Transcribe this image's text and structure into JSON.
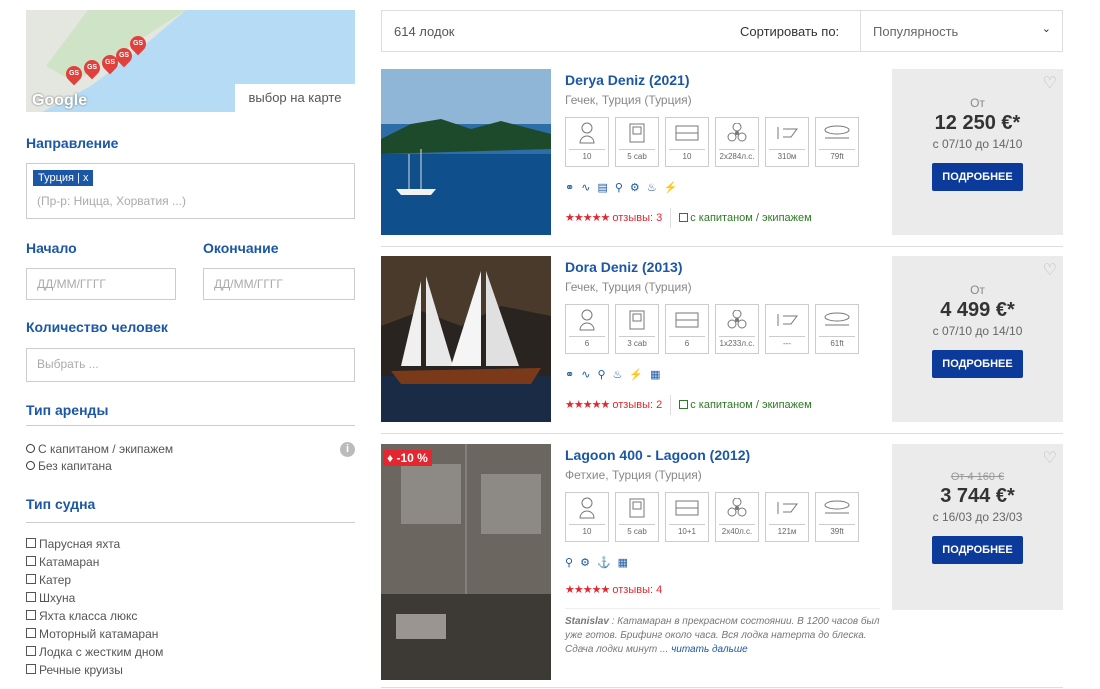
{
  "map": {
    "label": "выбор на карте",
    "logo": "Google",
    "pins": [
      "GS",
      "GS",
      "GS",
      "GS",
      "GS"
    ]
  },
  "filters": {
    "destination": {
      "heading": "Направление",
      "tag": "Турция",
      "tag_remove": "x",
      "placeholder": "(Пр-р: Ницца, Хорватия ...)"
    },
    "start": {
      "heading": "Начало",
      "placeholder": "ДД/ММ/ГГГГ"
    },
    "end": {
      "heading": "Окончание",
      "placeholder": "ДД/ММ/ГГГГ"
    },
    "people": {
      "heading": "Количество человек",
      "placeholder": "Выбрать ..."
    },
    "rental": {
      "heading": "Тип аренды",
      "options": [
        "С капитаном / экипажем",
        "Без капитана"
      ]
    },
    "boat_type": {
      "heading": "Тип судна",
      "options": [
        "Парусная яхта",
        "Катамаран",
        "Катер",
        "Шхуна",
        "Яхта класса люкс",
        "Моторный катамаран",
        "Лодка с жестким дном",
        "Речные круизы"
      ]
    }
  },
  "results": {
    "count": "614 лодок",
    "sort_label": "Сортировать по:",
    "sort_value": "Популярность"
  },
  "boats": [
    {
      "title": "Derya Deniz (2021)",
      "location": "Гечек, Турция (Турция)",
      "specs": [
        "10",
        "5 cab",
        "10",
        "2x284л.с.",
        "310м",
        "79ft"
      ],
      "stars": "★★★★★",
      "reviews": "отзывы: 3",
      "captain": "с капитаном / экипажем",
      "from": "От",
      "price": "12 250 €*",
      "dates": "с 07/10 до 14/10",
      "button": "ПОДРОБНЕЕ"
    },
    {
      "title": "Dora Deniz (2013)",
      "location": "Гечек, Турция (Турция)",
      "specs": [
        "6",
        "3 cab",
        "6",
        "1x233л.с.",
        "---",
        "61ft"
      ],
      "stars": "★★★★★",
      "reviews": "отзывы: 2",
      "captain": "с капитаном / экипажем",
      "from": "От",
      "price": "4 499 €*",
      "dates": "с 07/10 до 14/10",
      "button": "ПОДРОБНЕЕ"
    },
    {
      "title": "Lagoon 400 - Lagoon (2012)",
      "location": "Фетхие, Турция (Турция)",
      "specs": [
        "10",
        "5 cab",
        "10+1",
        "2x40л.с.",
        "121м",
        "39ft"
      ],
      "stars": "★★★★★",
      "reviews": "отзывы: 4",
      "discount": "-10 %",
      "old_price": "От 4 160 €",
      "price": "3 744 €*",
      "dates": "с 16/03 до 23/03",
      "button": "ПОДРОБНЕЕ",
      "review_author": "Stanislav",
      "review_text": " : Катамаран в прекрасном состоянии. В 1200 часов был уже готов. Брифинг около часа. Вся лодка натерта до блеска. Сдача лодки минут ... ",
      "review_more": "читать дальше"
    }
  ],
  "colors": {
    "accent": "#1b57a5",
    "button": "#0b3a9b",
    "stars": "#e3262f",
    "captain": "#2c7a23",
    "price_box": "#ebebeb"
  }
}
